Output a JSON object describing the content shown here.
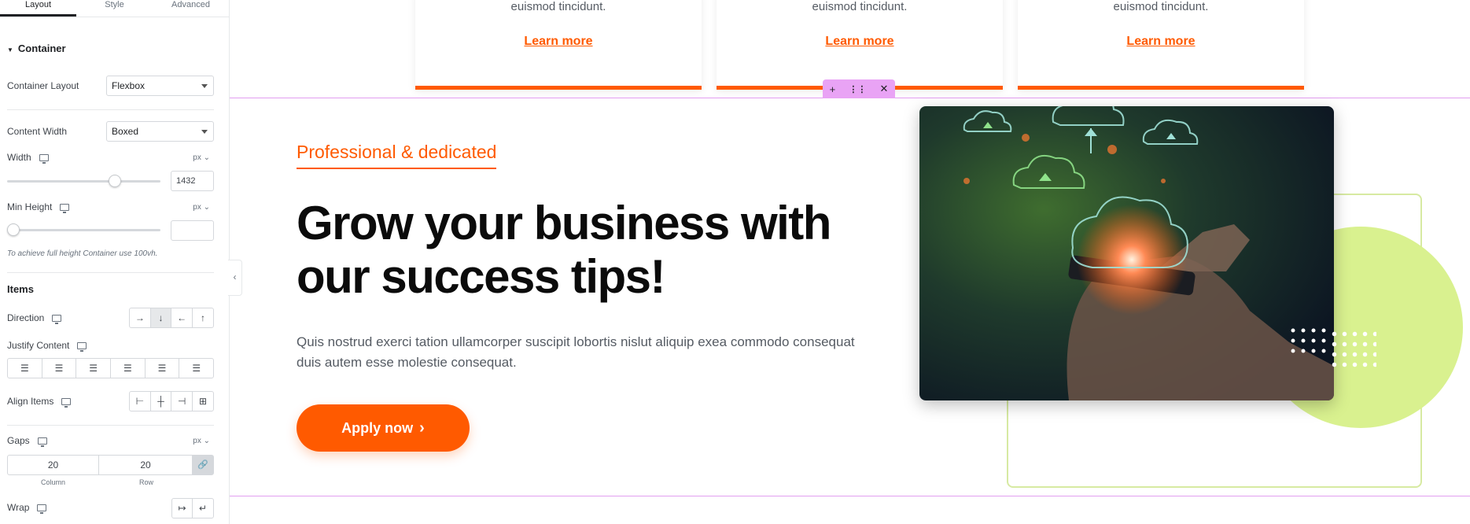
{
  "panel": {
    "tabs": [
      "Layout",
      "Style",
      "Advanced"
    ],
    "container_header": "Container",
    "container_layout": {
      "label": "Container Layout",
      "value": "Flexbox"
    },
    "content_width": {
      "label": "Content Width",
      "value": "Boxed"
    },
    "width": {
      "label": "Width",
      "unit": "px",
      "value": "1432",
      "slider_fraction": 0.72
    },
    "min_height": {
      "label": "Min Height",
      "unit": "px",
      "value": "",
      "slider_fraction": 0.0
    },
    "hint": "To achieve full height Container use 100vh.",
    "items_header": "Items",
    "direction": {
      "label": "Direction",
      "options": [
        "→",
        "↓",
        "←",
        "↑"
      ],
      "selected": 1
    },
    "justify": {
      "label": "Justify Content"
    },
    "align": {
      "label": "Align Items"
    },
    "gaps": {
      "label": "Gaps",
      "unit": "px",
      "column": "20",
      "row": "20",
      "column_caption": "Column",
      "row_caption": "Row"
    },
    "wrap": {
      "label": "Wrap"
    }
  },
  "cards": [
    {
      "text": "euismod tincidunt.",
      "link": "Learn more"
    },
    {
      "text": "euismod tincidunt.",
      "link": "Learn more"
    },
    {
      "text": "euismod tincidunt.",
      "link": "Learn more"
    }
  ],
  "section_handle": {
    "add": "+",
    "move": "⋮⋮",
    "close": "✕"
  },
  "hero": {
    "eyebrow": "Professional & dedicated",
    "headline": "Grow your business with our success tips!",
    "body": "Quis nostrud exerci tation ullamcorper suscipit lobortis nislut aliquip exea commodo consequat duis autem esse molestie consequat.",
    "cta": "Apply now"
  },
  "colors": {
    "accent": "#ff5a00",
    "lime": "#d9f18f",
    "handle": "#e9a3f5"
  }
}
